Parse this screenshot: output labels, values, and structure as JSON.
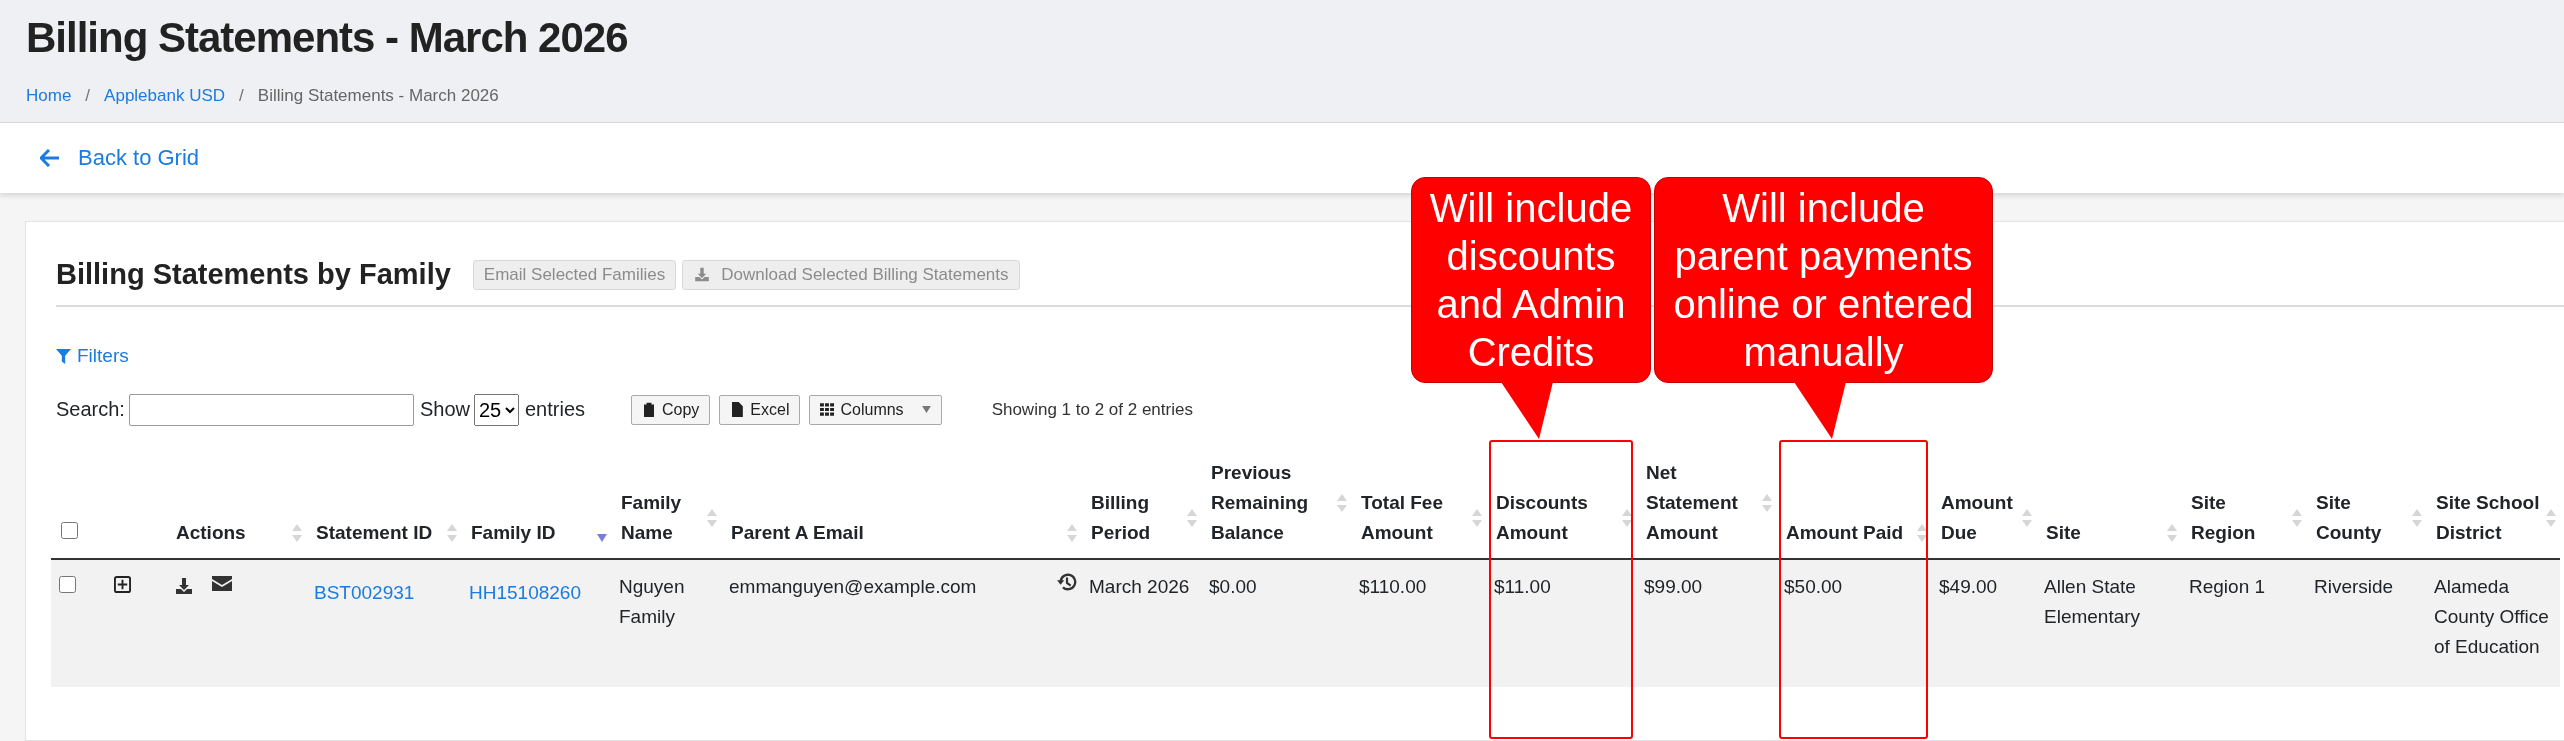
{
  "page_title": "Billing Statements - March 2026",
  "breadcrumb": [
    {
      "kind": "link",
      "label": "Home"
    },
    {
      "kind": "separator",
      "label": "/"
    },
    {
      "kind": "link",
      "label": "Applebank USD"
    },
    {
      "kind": "separator",
      "label": "/"
    },
    {
      "kind": "current",
      "label": "Billing Statements - March 2026"
    }
  ],
  "back_link": "Back to Grid",
  "card": {
    "title": "Billing Statements by Family",
    "actions": [
      {
        "kind": "email",
        "label": "Email Selected Families",
        "disabled": true
      },
      {
        "kind": "download",
        "label": "Download Selected Billing Statements",
        "disabled": true
      }
    ],
    "filters": "Filters",
    "search": {
      "label": "Search:"
    },
    "length": {
      "before": "Show",
      "value": "25",
      "after": "entries"
    },
    "tools": [
      {
        "kind": "copy",
        "label": "Copy"
      },
      {
        "kind": "excel",
        "label": "Excel"
      },
      {
        "kind": "columns",
        "label": "Columns"
      }
    ],
    "info": "Showing 1 to 2 of 2 entries",
    "table": {
      "columns": [
        {
          "kind": "checkbox",
          "checked": false,
          "highlighted": false
        },
        {
          "kind": "blank",
          "highlighted": false
        },
        {
          "kind": "text",
          "label": "Actions",
          "sorted_descending": false,
          "highlighted": false
        },
        {
          "kind": "text",
          "label": "Statement ID",
          "sorted_descending": false,
          "highlighted": false
        },
        {
          "kind": "text",
          "label": "Family ID",
          "sorted_descending": true,
          "highlighted": false
        },
        {
          "kind": "text",
          "label": "Family Name",
          "sorted_descending": false,
          "highlighted": false
        },
        {
          "kind": "text",
          "label": "Parent A Email",
          "sorted_descending": false,
          "highlighted": false
        },
        {
          "kind": "text",
          "label": "Billing Period",
          "sorted_descending": false,
          "highlighted": false
        },
        {
          "kind": "text",
          "label": "Previous Remaining Balance",
          "sorted_descending": false,
          "highlighted": false
        },
        {
          "kind": "text",
          "label": "Total Fee Amount",
          "sorted_descending": false,
          "highlighted": false
        },
        {
          "kind": "text",
          "label": "Discounts Amount",
          "sorted_descending": false,
          "highlighted": true,
          "callout": "Will include\ndiscounts\nand Admin\nCredits"
        },
        {
          "kind": "text",
          "label": "Net Statement Amount",
          "sorted_descending": false,
          "highlighted": false
        },
        {
          "kind": "text",
          "label": "Amount Paid",
          "sorted_descending": false,
          "highlighted": true,
          "callout": "Will include\nparent payments\nonline or entered\nmanually"
        },
        {
          "kind": "text",
          "label": "Amount Due",
          "sorted_descending": false,
          "highlighted": false
        },
        {
          "kind": "text",
          "label": "Site",
          "sorted_descending": false,
          "highlighted": false
        },
        {
          "kind": "text",
          "label": "Site Region",
          "sorted_descending": false,
          "highlighted": false
        },
        {
          "kind": "text",
          "label": "Site County",
          "sorted_descending": false,
          "highlighted": false
        },
        {
          "kind": "text",
          "label": "Site School District",
          "sorted_descending": false,
          "highlighted": false
        }
      ],
      "rows": [
        {
          "cells": [
            {
              "kind": "checkbox",
              "checked": false
            },
            {
              "kind": "expand"
            },
            {
              "kind": "actions"
            },
            {
              "kind": "link",
              "text": "BST002931"
            },
            {
              "kind": "link",
              "text": "HH15108260"
            },
            {
              "kind": "text",
              "text": "Nguyen Family"
            },
            {
              "kind": "history",
              "text": "emmanguyen@example.com"
            },
            {
              "kind": "text",
              "text": "March 2026"
            },
            {
              "kind": "text",
              "text": "$0.00"
            },
            {
              "kind": "text",
              "text": "$110.00"
            },
            {
              "kind": "text",
              "text": "$11.00"
            },
            {
              "kind": "text",
              "text": "$99.00"
            },
            {
              "kind": "text",
              "text": "$50.00"
            },
            {
              "kind": "text",
              "text": "$49.00"
            },
            {
              "kind": "text",
              "text": "Allen State Elementary"
            },
            {
              "kind": "text",
              "text": "Region 1"
            },
            {
              "kind": "text",
              "text": "Riverside"
            },
            {
              "kind": "text",
              "text": "Alameda County Office of Education"
            }
          ]
        }
      ]
    }
  }
}
